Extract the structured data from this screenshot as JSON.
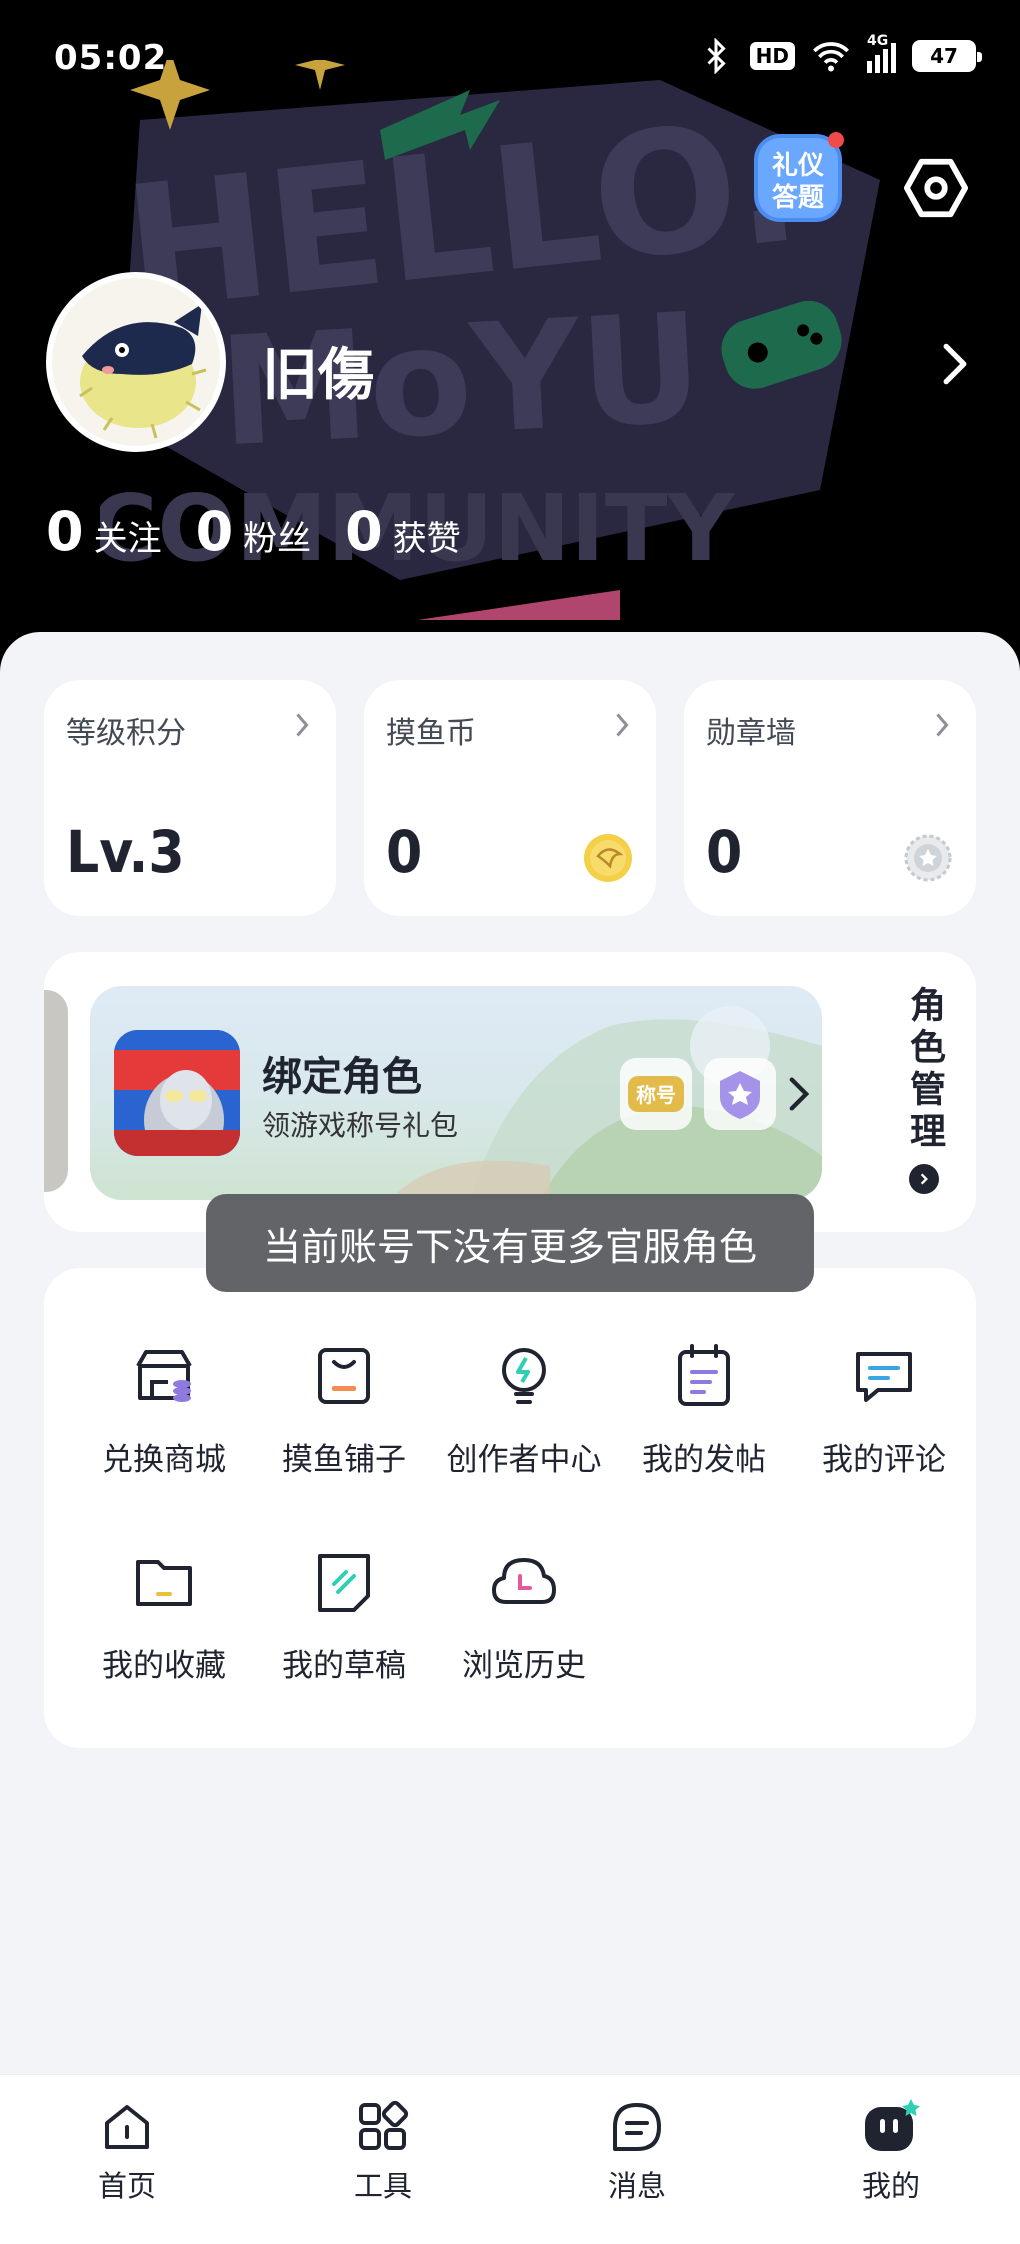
{
  "status_bar": {
    "time": "05:02",
    "hd": "HD",
    "network": "4G",
    "battery": "47"
  },
  "profile": {
    "username": "旧傷",
    "stats": [
      {
        "value": "0",
        "label": "关注"
      },
      {
        "value": "0",
        "label": "粉丝"
      },
      {
        "value": "0",
        "label": "获赞"
      }
    ],
    "quiz_badge_text": "礼仪答题",
    "background_text": "HELLO. MOYU COMMUNITY"
  },
  "cards": [
    {
      "title": "等级积分",
      "value": "Lv.3",
      "icon": "level-icon"
    },
    {
      "title": "摸鱼币",
      "value": "0",
      "icon": "coin-icon"
    },
    {
      "title": "勋章墙",
      "value": "0",
      "icon": "medal-icon"
    }
  ],
  "role": {
    "title": "绑定角色",
    "subtitle": "领游戏称号礼包",
    "badge_a": "称号",
    "manage_label": "角色管理"
  },
  "toast": "当前账号下没有更多官服角色",
  "tools": [
    {
      "label": "兑换商城",
      "icon": "store-icon"
    },
    {
      "label": "摸鱼铺子",
      "icon": "shop-bag-icon"
    },
    {
      "label": "创作者中心",
      "icon": "lightbulb-icon"
    },
    {
      "label": "我的发帖",
      "icon": "post-icon"
    },
    {
      "label": "我的评论",
      "icon": "comment-icon"
    },
    {
      "label": "我的收藏",
      "icon": "folder-icon"
    },
    {
      "label": "我的草稿",
      "icon": "draft-icon"
    },
    {
      "label": "浏览历史",
      "icon": "history-icon"
    }
  ],
  "nav": [
    {
      "label": "首页",
      "icon": "home-icon"
    },
    {
      "label": "工具",
      "icon": "tools-icon"
    },
    {
      "label": "消息",
      "icon": "message-icon"
    },
    {
      "label": "我的",
      "icon": "profile-icon"
    }
  ],
  "colors": {
    "header_bg": "#000000",
    "panel_bg": "#f2f4f7",
    "accent_teal": "#2ecfb3",
    "accent_purple": "#7a6bd8",
    "accent_orange": "#f28d4f"
  }
}
